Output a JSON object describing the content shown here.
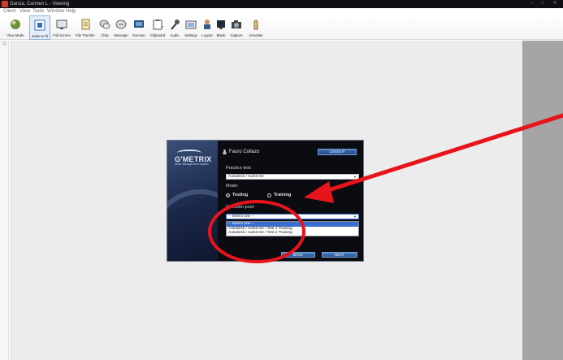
{
  "window": {
    "title": "Garcia, Carmen L - Viewing"
  },
  "menu": [
    "Client",
    "View",
    "Tools",
    "Window",
    "Help"
  ],
  "toolbar": [
    {
      "label": "View Mode",
      "icon": "view-mode-icon"
    },
    {
      "label": "Scale to fit",
      "icon": "scale-to-fit-icon"
    },
    {
      "label": "Full Screen",
      "icon": "full-screen-icon"
    },
    {
      "label": "File Transfer",
      "icon": "file-transfer-icon"
    },
    {
      "label": "Chat",
      "icon": "chat-icon"
    },
    {
      "label": "Message",
      "icon": "message-icon"
    },
    {
      "label": "Execute",
      "icon": "execute-icon"
    },
    {
      "label": "Clipboard",
      "icon": "clipboard-icon"
    },
    {
      "label": "Audio",
      "icon": "audio-icon"
    },
    {
      "label": "Settings",
      "icon": "settings-icon"
    },
    {
      "label": "Logout",
      "icon": "logout-icon"
    },
    {
      "label": "Blank",
      "icon": "blank-icon"
    },
    {
      "label": "Capture",
      "icon": "capture-icon"
    },
    {
      "label": "Annotate",
      "icon": "annotate-icon"
    }
  ],
  "dialog": {
    "brand": {
      "logo": "G'METRIX",
      "tagline": "Skills Management System"
    },
    "user": "Fauro Collazo",
    "logout_label": "LOGOUT",
    "practice_label": "Practice test:",
    "practice_value": "Autodesk / AutoCAD",
    "mode_label": "Mode:",
    "mode_testing": "Testing",
    "mode_training": "Training",
    "pool_label": "Question pool:",
    "pool_selected": "-- Select one --",
    "pool_options": [
      "-- Select one --",
      "Autodesk / AutoCAD / Test 1 Training",
      "Autodesk / AutoCAD / Test 2 Training"
    ],
    "back_label": "BACK",
    "next_label": "NEXT"
  },
  "colors": {
    "annotation": "#e8141b",
    "accent": "#2f5fa8"
  }
}
